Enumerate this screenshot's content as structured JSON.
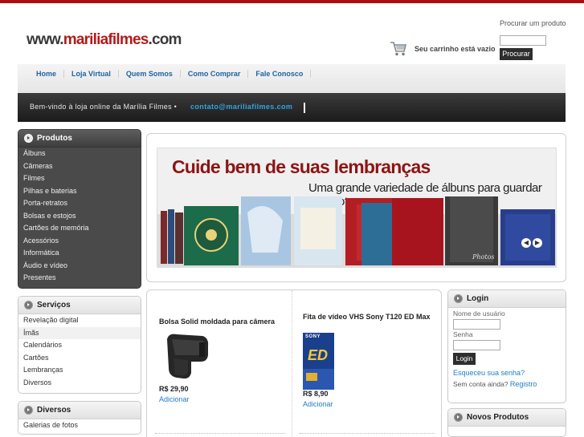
{
  "header": {
    "logo_prefix": "www.",
    "logo_main": "mariliafilmes",
    "logo_suffix": ".com",
    "search_label": "Procurar um produto",
    "search_value": "",
    "search_button": "Procurar",
    "cart_text": "Seu carrinho está vazio"
  },
  "nav": {
    "items": [
      "Home",
      "Loja Virtual",
      "Quem Somos",
      "Como Comprar",
      "Fale Conosco"
    ]
  },
  "welcome": {
    "text": "Bem-vindo à loja online da Marília Filmes •",
    "email": "contato@mariliafilmes.com"
  },
  "sidebar": {
    "produtos": {
      "title": "Produtos",
      "items": [
        "Álbuns",
        "Câmeras",
        "Filmes",
        "Pilhas e baterias",
        "Porta-retratos",
        "Bolsas e estojos",
        "Cartões de memória",
        "Acessórios",
        "Informática",
        "Áudio e vídeo",
        "Presentes"
      ]
    },
    "servicos": {
      "title": "Serviços",
      "items": [
        "Revelação digital",
        "Ímãs",
        "Calendários",
        "Cartões",
        "Lembranças",
        "Diversos"
      ]
    },
    "diversos": {
      "title": "Diversos",
      "items": [
        "Galerias de fotos"
      ]
    }
  },
  "banner": {
    "title": "Cuide bem de suas lembranças",
    "subtitle": "Uma grande variedade de álbuns para guardar suas fotos",
    "album_script": "Photos"
  },
  "products": [
    {
      "name": "Bolsa Solid moldada para câmera",
      "price": "R$ 29,90",
      "add": "Adicionar"
    },
    {
      "name": "Fita de vídeo VHS Sony T120 ED Max",
      "price": "R$ 8,90",
      "add": "Adicionar",
      "package_brand": "SONY",
      "package_code": "ED"
    }
  ],
  "login": {
    "title": "Login",
    "username_label": "Nome de usuário",
    "password_label": "Senha",
    "button": "Login",
    "forgot": "Esqueceu sua senha?",
    "no_account": "Sem conta ainda?",
    "register": "Registro"
  },
  "novos_produtos": {
    "title": "Novos Produtos"
  },
  "colors": {
    "accent_red": "#a90f0f",
    "link_blue": "#1f7ec5",
    "nav_blue": "#1f63a3",
    "email_blue": "#35a3e2"
  }
}
